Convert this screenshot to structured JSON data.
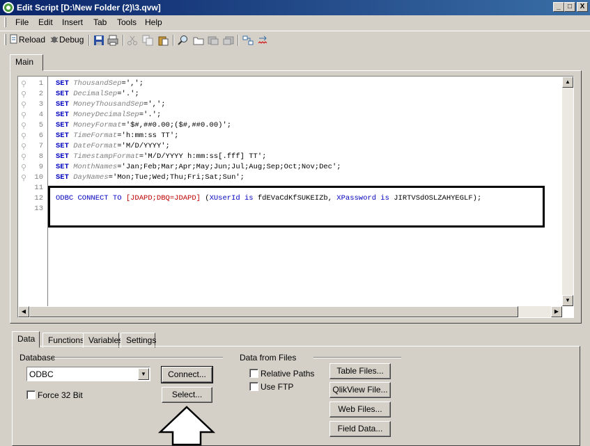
{
  "window": {
    "title": "Edit Script [D:\\New Folder (2)\\3.qvw]",
    "min": "_",
    "max": "□",
    "close": "X"
  },
  "menu": [
    "File",
    "Edit",
    "Insert",
    "Tab",
    "Tools",
    "Help"
  ],
  "toolbar": {
    "reload": "Reload",
    "debug": "Debug"
  },
  "tabs": {
    "main": "Main"
  },
  "code": [
    {
      "n": "1",
      "parts": [
        [
          "kw",
          "SET "
        ],
        [
          "var",
          "ThousandSep"
        ],
        [
          "str",
          "=',';"
        ]
      ]
    },
    {
      "n": "2",
      "parts": [
        [
          "kw",
          "SET "
        ],
        [
          "var",
          "DecimalSep"
        ],
        [
          "str",
          "='.';"
        ]
      ]
    },
    {
      "n": "3",
      "parts": [
        [
          "kw",
          "SET "
        ],
        [
          "var",
          "MoneyThousandSep"
        ],
        [
          "str",
          "=',';"
        ]
      ]
    },
    {
      "n": "4",
      "parts": [
        [
          "kw",
          "SET "
        ],
        [
          "var",
          "MoneyDecimalSep"
        ],
        [
          "str",
          "='.';"
        ]
      ]
    },
    {
      "n": "5",
      "parts": [
        [
          "kw",
          "SET "
        ],
        [
          "var",
          "MoneyFormat"
        ],
        [
          "str",
          "='$#,##0.00;($#,##0.00)';"
        ]
      ]
    },
    {
      "n": "6",
      "parts": [
        [
          "kw",
          "SET "
        ],
        [
          "var",
          "TimeFormat"
        ],
        [
          "str",
          "='h:mm:ss TT';"
        ]
      ]
    },
    {
      "n": "7",
      "parts": [
        [
          "kw",
          "SET "
        ],
        [
          "var",
          "DateFormat"
        ],
        [
          "str",
          "='M/D/YYYY';"
        ]
      ]
    },
    {
      "n": "8",
      "parts": [
        [
          "kw",
          "SET "
        ],
        [
          "var",
          "TimestampFormat"
        ],
        [
          "str",
          "='M/D/YYYY h:mm:ss[.fff] TT';"
        ]
      ]
    },
    {
      "n": "9",
      "parts": [
        [
          "kw",
          "SET "
        ],
        [
          "var",
          "MonthNames"
        ],
        [
          "str",
          "='Jan;Feb;Mar;Apr;May;Jun;Jul;Aug;Sep;Oct;Nov;Dec';"
        ]
      ]
    },
    {
      "n": "10",
      "parts": [
        [
          "kw",
          "SET "
        ],
        [
          "var",
          "DayNames"
        ],
        [
          "str",
          "='Mon;Tue;Wed;Thu;Fri;Sat;Sun';"
        ]
      ]
    },
    {
      "n": "11",
      "parts": []
    },
    {
      "n": "12",
      "parts": [
        [
          "kw2",
          "ODBC CONNECT TO "
        ],
        [
          "cn",
          "[JDAPD;DBQ=JDAPD]"
        ],
        [
          "str",
          " ("
        ],
        [
          "kw2",
          "XUserId is "
        ],
        [
          "str",
          "fdEVaCdKfSUKEIZb, "
        ],
        [
          "kw2",
          "XPassword is "
        ],
        [
          "str",
          "JIRTVSdOSLZAHYEGLF);"
        ]
      ]
    },
    {
      "n": "13",
      "parts": []
    }
  ],
  "bottom_tabs": [
    "Data",
    "Functions",
    "Variables",
    "Settings"
  ],
  "database": {
    "group_title": "Database",
    "driver": "ODBC",
    "force32": "Force 32 Bit",
    "connect": "Connect...",
    "select": "Select..."
  },
  "files": {
    "group_title": "Data from Files",
    "relative_paths": "Relative Paths",
    "use_ftp": "Use FTP",
    "table_files": "Table Files...",
    "qlikview_file": "QlikView File...",
    "web_files": "Web Files...",
    "field_data": "Field Data..."
  }
}
